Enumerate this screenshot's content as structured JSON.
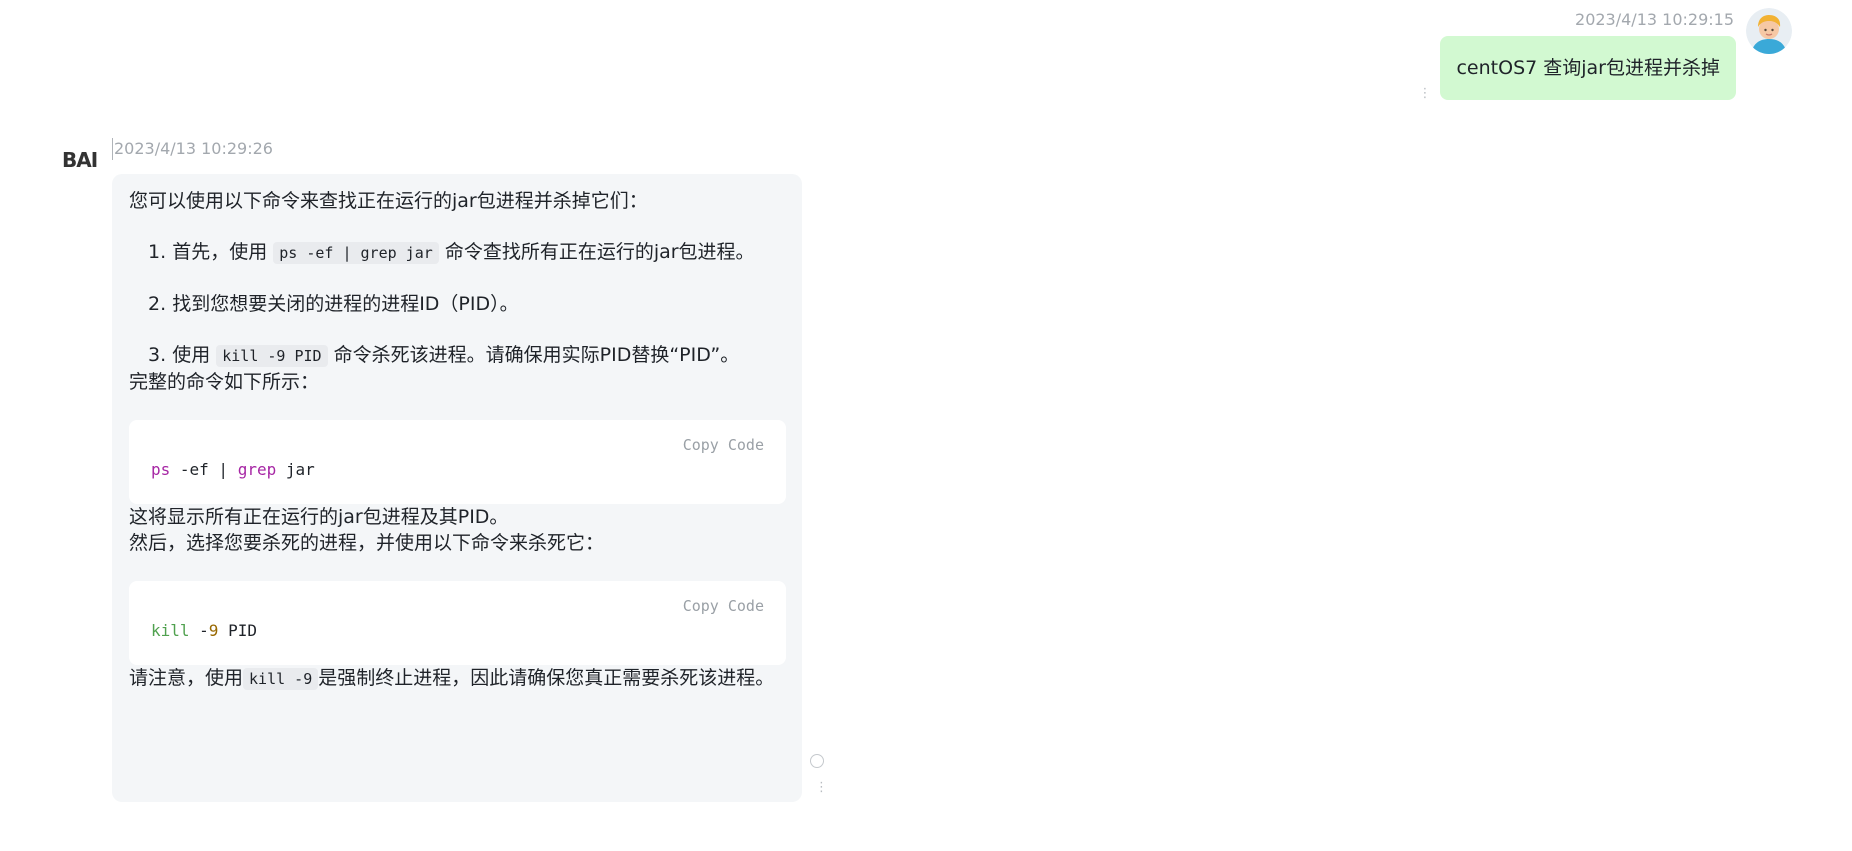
{
  "user_message": {
    "timestamp": "2023/4/13 10:29:15",
    "text": "centOS7 查询jar包进程并杀掉",
    "avatar_icon": "user-avatar-icon",
    "more_icon": "⋮",
    "bubble_color": "#d2f9d1"
  },
  "bot_message": {
    "logo_text": "BAI",
    "timestamp": "2023/4/13 10:29:26",
    "bubble_color": "#f4f6f8",
    "intro": "您可以使用以下命令来查找正在运行的jar包进程并杀掉它们：",
    "steps": [
      {
        "num": "1.",
        "before": "首先，使用",
        "code": "ps -ef | grep jar",
        "after": "命令查找所有正在运行的jar包进程。"
      },
      {
        "num": "2.",
        "before": "找到您想要关闭的进程的进程ID（PID）。",
        "code": "",
        "after": ""
      },
      {
        "num": "3.",
        "before": "使用",
        "code": "kill -9 PID",
        "after": "命令杀死该进程。请确保用实际PID替换“PID”。"
      }
    ],
    "full_command_label": "完整的命令如下所示：",
    "code_block_1": {
      "copy_label": "Copy Code",
      "tokens": [
        "ps",
        " -ef | ",
        "grep",
        " jar"
      ]
    },
    "after_code_1": "这将显示所有正在运行的jar包进程及其PID。",
    "after_code_2": "然后，选择您要杀死的进程，并使用以下命令来杀死它：",
    "code_block_2": {
      "copy_label": "Copy Code",
      "tokens": [
        "kill",
        " -",
        "9",
        " PID"
      ]
    },
    "final_before": "请注意，使用",
    "final_code": "kill -9",
    "final_after": "是强制终止进程，因此请确保您真正需要杀死该进程。",
    "more_icon": "⋮"
  }
}
